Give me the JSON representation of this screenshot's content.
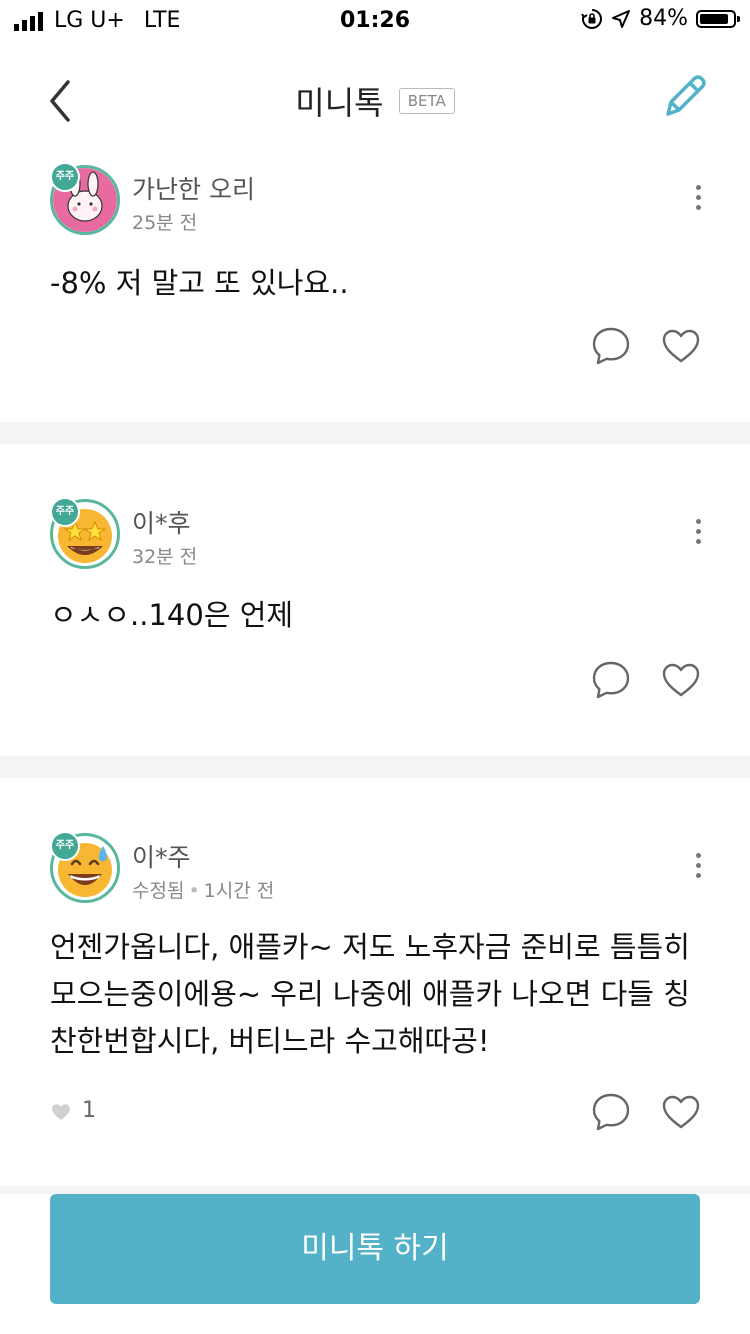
{
  "status_bar": {
    "carrier": "LG U+",
    "network": "LTE",
    "time": "01:26",
    "battery": "84%"
  },
  "header": {
    "title": "미니톡",
    "badge": "BETA"
  },
  "posts": [
    {
      "author": "가난한 오리",
      "meta_time": "25분 전",
      "content": "-8% 저 말고 또 있나요..",
      "avatar_icon": "rabbit-avatar"
    },
    {
      "author": "이*후",
      "meta_time": "32분 전",
      "content": "ㅇㅅㅇ..140은 언제",
      "avatar_icon": "star-struck-emoji"
    },
    {
      "author": "이*주",
      "meta_edited": "수정됨",
      "meta_time": "1시간 전",
      "content": "언젠가옵니다, 애플카~ 저도 노후자금 준비로 틈틈히 모으는중이에용~ 우리 나중에 애플카 나오면 다들 칭찬한번합시다, 버티느라 수고해따공!",
      "like_count": "1",
      "avatar_icon": "sweat-smile-emoji"
    }
  ],
  "avatar_badge": "주주",
  "cta": {
    "label": "미니톡 하기"
  },
  "colors": {
    "accent": "#53b2c8",
    "badge": "#43a895"
  }
}
